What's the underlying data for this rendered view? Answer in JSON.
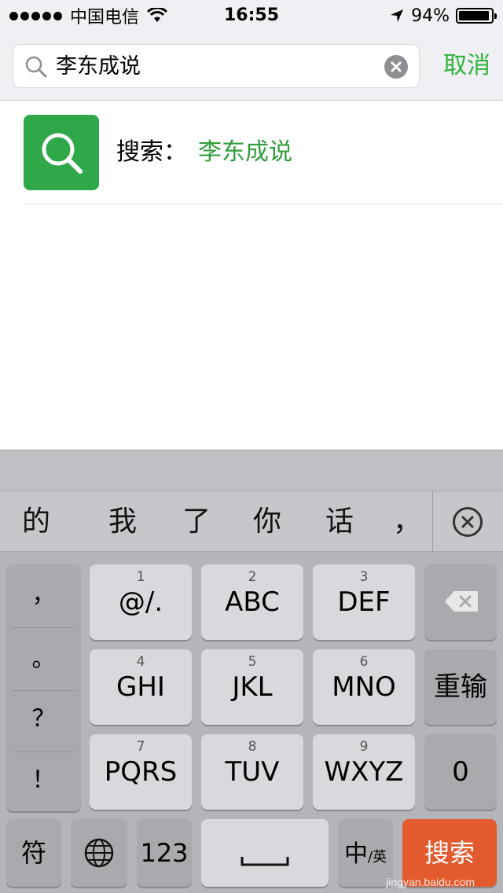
{
  "status_bar": {
    "carrier": "中国电信",
    "time": "16:55",
    "battery": "94%",
    "battery_level": 0.94
  },
  "search": {
    "value": "李东成说",
    "cancel_label": "取消"
  },
  "result": {
    "prefix": "搜索：",
    "query": "李东成说"
  },
  "keyboard": {
    "candidates": [
      "的",
      "我",
      "了",
      "你",
      "话",
      "，"
    ],
    "punctuation": [
      "，",
      "。",
      "？",
      "！"
    ],
    "keys": [
      {
        "num": "1",
        "label": "@/."
      },
      {
        "num": "2",
        "label": "ABC"
      },
      {
        "num": "3",
        "label": "DEF"
      },
      {
        "num": "4",
        "label": "GHI"
      },
      {
        "num": "5",
        "label": "JKL"
      },
      {
        "num": "6",
        "label": "MNO"
      },
      {
        "num": "7",
        "label": "PQRS"
      },
      {
        "num": "8",
        "label": "TUV"
      },
      {
        "num": "9",
        "label": "WXYZ"
      }
    ],
    "reenter_label": "重输",
    "zero_label": "0",
    "symbols_label": "符",
    "numbers_label": "123",
    "lang_zh": "中",
    "lang_en": "/英",
    "search_label": "搜索"
  },
  "watermark": "jingyan.baidu.com",
  "colors": {
    "accent_green": "#2fb43a",
    "search_key": "#e35a2f"
  }
}
